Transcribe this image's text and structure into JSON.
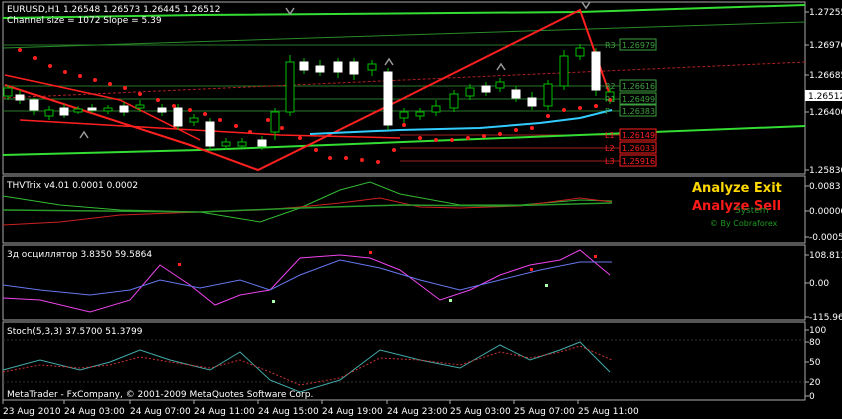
{
  "main": {
    "symbol_line": "EURUSD,H1  1.26548 1.26573 1.26445 1.26512",
    "channel_info": "Channel size = 1072 Slope = 5.39",
    "y_ticks": [
      "1.27255",
      "1.26970",
      "1.26685",
      "1.26400",
      "1.25830"
    ],
    "current_price": "1.26512",
    "level_labels": [
      {
        "text": "1.26979",
        "color": "#3ea03e"
      },
      {
        "text": "1.26616",
        "color": "#3ea03e"
      },
      {
        "text": "1.26499",
        "color": "#3ea03e"
      },
      {
        "text": "1.26383",
        "color": "#3ea03e"
      },
      {
        "text": "1.26149",
        "color": "#ff2020"
      },
      {
        "text": "1.26033",
        "color": "#ff2020"
      },
      {
        "text": "1.25916",
        "color": "#ff2020"
      }
    ],
    "level_tags": [
      "R3",
      "R2",
      "R1",
      "P",
      "L1",
      "L2",
      "L3"
    ]
  },
  "thv": {
    "title": "THVTrix v4.01 0.0001 0.0002",
    "y_ticks": [
      "0.0083",
      "0.00000",
      "-0.0005"
    ],
    "analyze_exit": "Analyze Exit",
    "analyze_sell": "Analyze Sell",
    "system": "System",
    "brand": "© By Cobraforex"
  },
  "osc3d": {
    "title": "3д осциллятор 3.8350 59.5864",
    "y_ticks": [
      "108.813",
      "0.00",
      "-115.96"
    ]
  },
  "stoch": {
    "title": "Stoch(5,3,3) 37.5700 51.3799",
    "y_ticks": [
      "100",
      "80",
      "50",
      "20",
      "0"
    ]
  },
  "copyright": "MetaTrader - FxCompany, © 2001-2009 MetaQuotes Software Corp.",
  "x_ticks": [
    "23 Aug 2010",
    "24 Aug 03:00",
    "24 Aug 07:00",
    "24 Aug 11:00",
    "24 Aug 15:00",
    "24 Aug 19:00",
    "24 Aug 23:00",
    "25 Aug 03:00",
    "25 Aug 07:00",
    "25 Aug 11:00"
  ],
  "colors": {
    "bull": "#00c000",
    "bear": "#ffffff",
    "channel": "#33dd33",
    "trend": "#ff2020",
    "ma": "#33ccff",
    "thv_green": "#33bb33",
    "thv_red": "#cc2020",
    "osc_magenta": "#ee44ee",
    "osc_blue": "#6677ee",
    "stoch_cyan": "#44aaaa",
    "stoch_red": "#cc3333"
  }
}
